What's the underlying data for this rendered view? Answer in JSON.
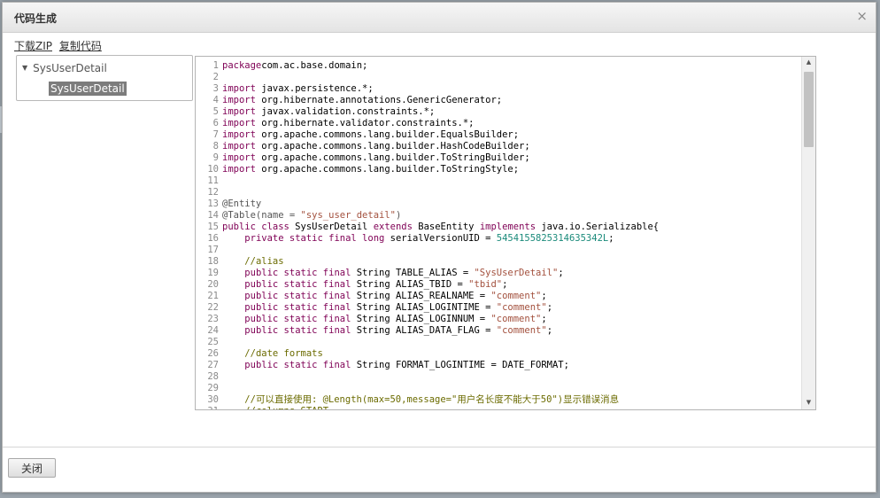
{
  "dialog": {
    "title": "代码生成",
    "close_glyph": "×",
    "links": {
      "download": "下载ZIP",
      "copy": "复制代码"
    },
    "close_button": "关闭"
  },
  "tree": {
    "root": "SysUserDetail",
    "child": "SysUserDetail"
  },
  "code": {
    "lines": [
      [
        [
          "kw",
          "package"
        ],
        [
          "",
          "com.ac.base.domain;"
        ]
      ],
      [],
      [
        [
          "kw",
          "import"
        ],
        [
          "",
          " javax.persistence.*;"
        ]
      ],
      [
        [
          "kw",
          "import"
        ],
        [
          "",
          " org.hibernate.annotations.GenericGenerator;"
        ]
      ],
      [
        [
          "kw",
          "import"
        ],
        [
          "",
          " javax.validation.constraints.*;"
        ]
      ],
      [
        [
          "kw",
          "import"
        ],
        [
          "",
          " org.hibernate.validator.constraints.*;"
        ]
      ],
      [
        [
          "kw",
          "import"
        ],
        [
          "",
          " org.apache.commons.lang.builder.EqualsBuilder;"
        ]
      ],
      [
        [
          "kw",
          "import"
        ],
        [
          "",
          " org.apache.commons.lang.builder.HashCodeBuilder;"
        ]
      ],
      [
        [
          "kw",
          "import"
        ],
        [
          "",
          " org.apache.commons.lang.builder.ToStringBuilder;"
        ]
      ],
      [
        [
          "kw",
          "import"
        ],
        [
          "",
          " org.apache.commons.lang.builder.ToStringStyle;"
        ]
      ],
      [],
      [],
      [
        [
          "an",
          "@Entity"
        ]
      ],
      [
        [
          "an",
          "@Table(name = "
        ],
        [
          "str",
          "\"sys_user_detail\""
        ],
        [
          "an",
          ")"
        ]
      ],
      [
        [
          "kw",
          "public class"
        ],
        [
          "",
          " SysUserDetail "
        ],
        [
          "kw",
          "extends"
        ],
        [
          "",
          " BaseEntity "
        ],
        [
          "kw",
          "implements"
        ],
        [
          "",
          " java.io.Serializable{"
        ]
      ],
      [
        [
          "",
          "    "
        ],
        [
          "kw",
          "private static final long"
        ],
        [
          "",
          " serialVersionUID = "
        ],
        [
          "num",
          "5454155825314635342L"
        ],
        [
          "",
          ";"
        ]
      ],
      [],
      [
        [
          "",
          "    "
        ],
        [
          "cm",
          "//alias"
        ]
      ],
      [
        [
          "",
          "    "
        ],
        [
          "kw",
          "public static final"
        ],
        [
          "",
          " String TABLE_ALIAS = "
        ],
        [
          "str",
          "\"SysUserDetail\""
        ],
        [
          "",
          ";"
        ]
      ],
      [
        [
          "",
          "    "
        ],
        [
          "kw",
          "public static final"
        ],
        [
          "",
          " String ALIAS_TBID = "
        ],
        [
          "str",
          "\"tbid\""
        ],
        [
          "",
          ";"
        ]
      ],
      [
        [
          "",
          "    "
        ],
        [
          "kw",
          "public static final"
        ],
        [
          "",
          " String ALIAS_REALNAME = "
        ],
        [
          "str",
          "\"comment\""
        ],
        [
          "",
          ";"
        ]
      ],
      [
        [
          "",
          "    "
        ],
        [
          "kw",
          "public static final"
        ],
        [
          "",
          " String ALIAS_LOGINTIME = "
        ],
        [
          "str",
          "\"comment\""
        ],
        [
          "",
          ";"
        ]
      ],
      [
        [
          "",
          "    "
        ],
        [
          "kw",
          "public static final"
        ],
        [
          "",
          " String ALIAS_LOGINNUM = "
        ],
        [
          "str",
          "\"comment\""
        ],
        [
          "",
          ";"
        ]
      ],
      [
        [
          "",
          "    "
        ],
        [
          "kw",
          "public static final"
        ],
        [
          "",
          " String ALIAS_DATA_FLAG = "
        ],
        [
          "str",
          "\"comment\""
        ],
        [
          "",
          ";"
        ]
      ],
      [],
      [
        [
          "",
          "    "
        ],
        [
          "cm",
          "//date formats"
        ]
      ],
      [
        [
          "",
          "    "
        ],
        [
          "kw",
          "public static final"
        ],
        [
          "",
          " String FORMAT_LOGINTIME = DATE_FORMAT;"
        ]
      ],
      [],
      [],
      [
        [
          "",
          "    "
        ],
        [
          "cm",
          "//可以直接使用: @Length(max=50,message=\"用户名长度不能大于50\")显示错误消息"
        ]
      ],
      [
        [
          "",
          "    "
        ],
        [
          "cm",
          "//columns START"
        ]
      ]
    ]
  }
}
